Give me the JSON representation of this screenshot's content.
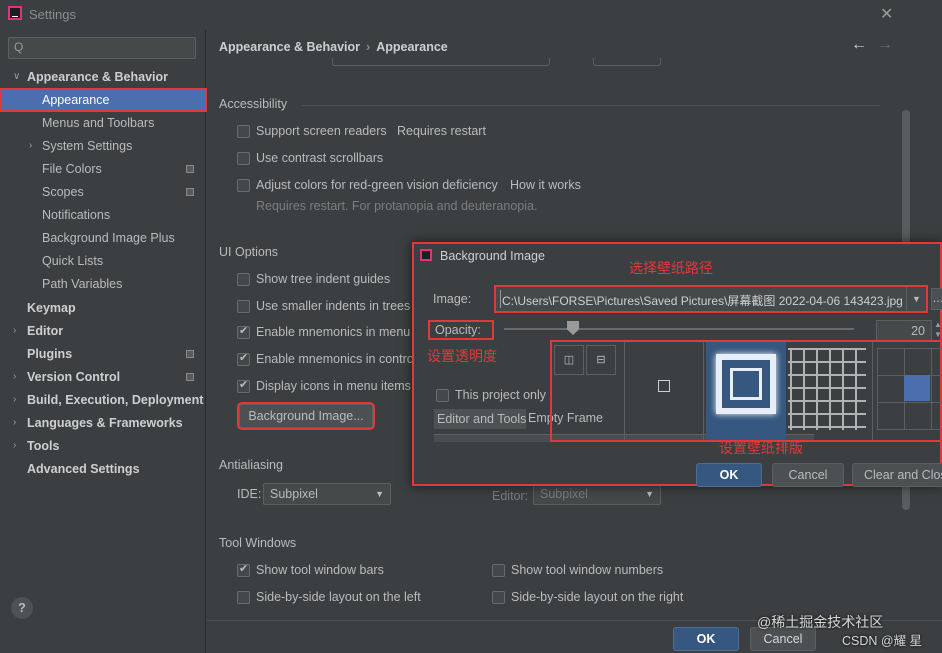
{
  "window": {
    "title": "Settings",
    "close": "✕"
  },
  "sidebar": {
    "search_placeholder": "Q",
    "items": [
      {
        "label": "Appearance & Behavior",
        "expanded": "∨"
      },
      {
        "label": "Appearance"
      },
      {
        "label": "Menus and Toolbars"
      },
      {
        "label": "System Settings",
        "expand": "›"
      },
      {
        "label": "File Colors"
      },
      {
        "label": "Scopes"
      },
      {
        "label": "Notifications"
      },
      {
        "label": "Background Image Plus"
      },
      {
        "label": "Quick Lists"
      },
      {
        "label": "Path Variables"
      },
      {
        "label": "Keymap"
      },
      {
        "label": "Editor",
        "expand": "›"
      },
      {
        "label": "Plugins"
      },
      {
        "label": "Version Control",
        "expand": "›"
      },
      {
        "label": "Build, Execution, Deployment",
        "expand": "›"
      },
      {
        "label": "Languages & Frameworks",
        "expand": "›"
      },
      {
        "label": "Tools",
        "expand": "›"
      },
      {
        "label": "Advanced Settings"
      }
    ],
    "help": "?"
  },
  "header": {
    "crumb1": "Appearance & Behavior",
    "sep": "›",
    "crumb2": "Appearance",
    "back": "←",
    "forward": "→"
  },
  "accessibility": {
    "title": "Accessibility",
    "screen_readers": "Support screen readers",
    "requires_restart": "Requires restart",
    "contrast_scrollbars": "Use contrast scrollbars",
    "red_green": "Adjust colors for red-green vision deficiency",
    "how_it_works": "How it works",
    "red_green_hint": "Requires restart. For protanopia and deuteranopia."
  },
  "ui_options": {
    "title": "UI Options",
    "tree_indent": "Show tree indent guides",
    "smaller_indents": "Use smaller indents in trees",
    "mnemonics_menu": "Enable mnemonics in menu",
    "mnemonics_controls": "Enable mnemonics in controls",
    "icons_menu": "Display icons in menu items",
    "bg_image_button": "Background Image..."
  },
  "antialiasing": {
    "title": "Antialiasing",
    "ide_label": "IDE:",
    "ide_value": "Subpixel",
    "editor_label": "Editor:",
    "editor_value": "Subpixel"
  },
  "tool_windows": {
    "title": "Tool Windows",
    "show_bars": "Show tool window bars",
    "show_numbers": "Show tool window numbers",
    "side_left": "Side-by-side layout on the left",
    "side_right": "Side-by-side layout on the right"
  },
  "dialog": {
    "title": "Background Image",
    "image_label": "Image:",
    "image_path": "C:\\Users\\FORSE\\Pictures\\Saved Pictures\\屏幕截图 2022-04-06 143423.jpg",
    "browse": "...",
    "opacity_label": "Opacity:",
    "opacity_value": "20",
    "opacity_fraction": 0.2,
    "project_only": "This project only",
    "target_selected": "Editor and Tools",
    "target_other": "Empty Frame",
    "ok": "OK",
    "cancel": "Cancel",
    "clear_close": "Clear and Close"
  },
  "annotations": {
    "path": "选择壁纸路径",
    "opacity": "设置透明度",
    "layout": "设置壁纸排版"
  },
  "footer": {
    "ok": "OK",
    "cancel": "Cancel"
  },
  "watermarks": {
    "juejin": "@稀土掘金技术社区",
    "csdn": "CSDN @耀 星"
  },
  "colors": {
    "accent": "#4b6eaf",
    "highlight": "#e0393c",
    "background": "#3c3f41",
    "link": "#589df6"
  }
}
